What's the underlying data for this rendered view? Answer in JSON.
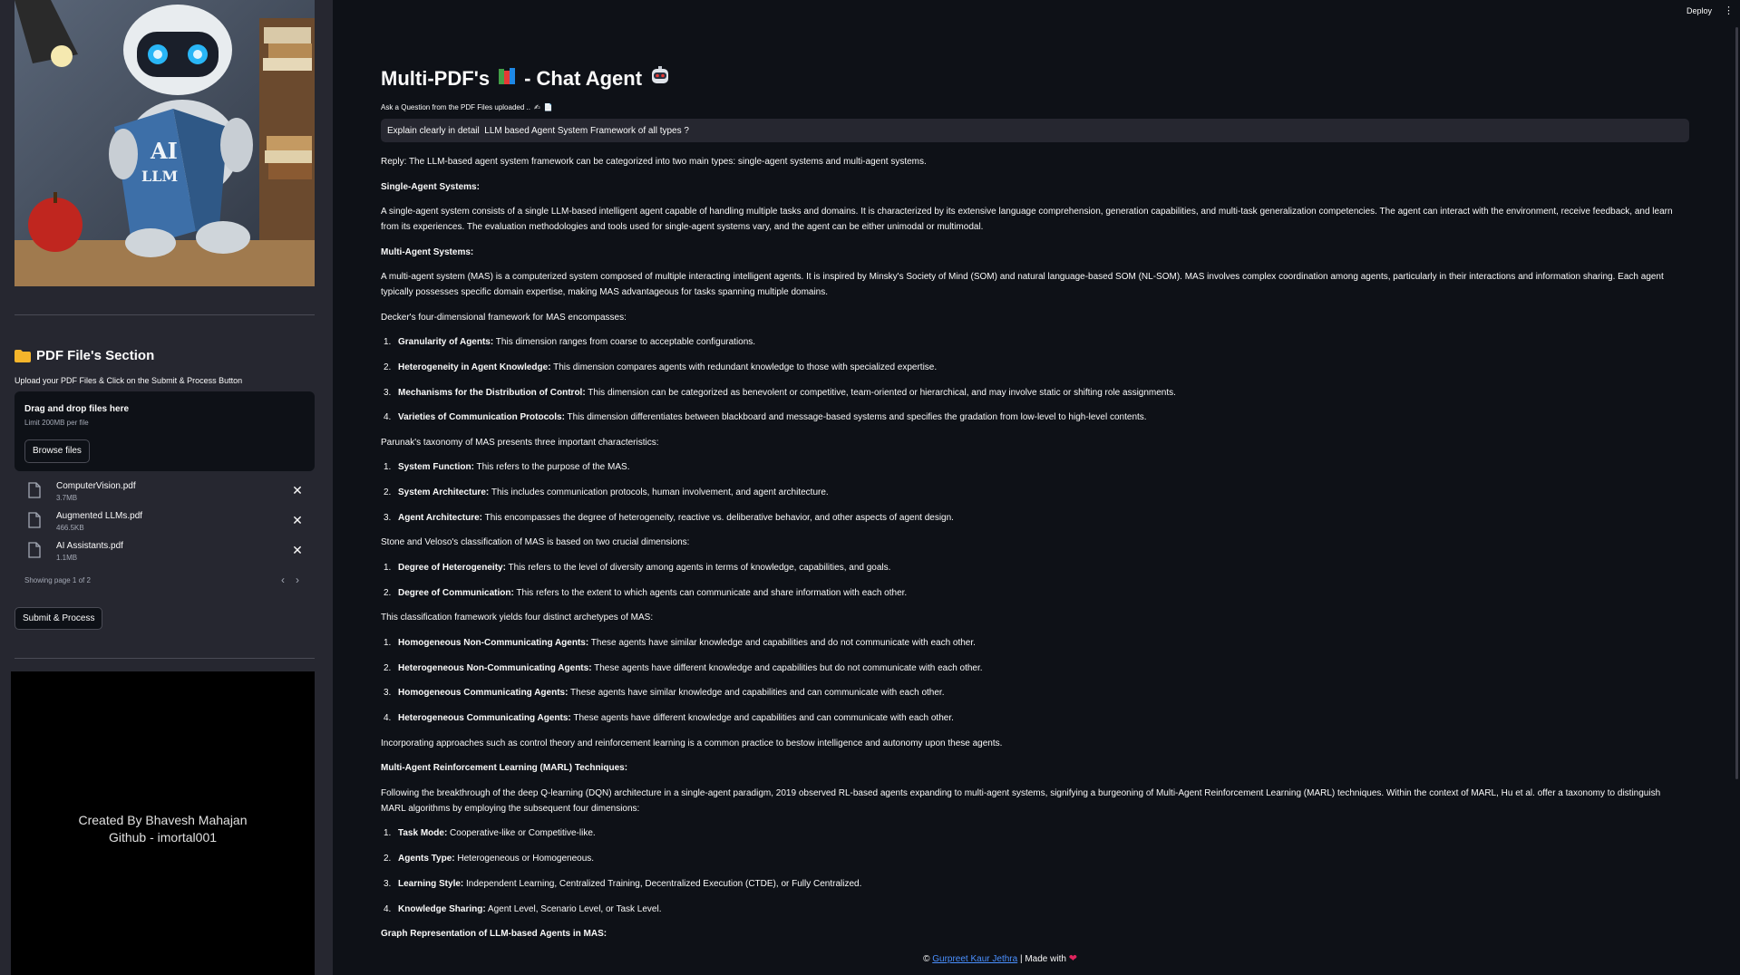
{
  "header": {
    "deploy_label": "Deploy",
    "more_label": "⋮"
  },
  "sidebar": {
    "section_title": "PDF File's Section",
    "upload_hint": "Upload your PDF Files & Click on the Submit & Process Button",
    "dropzone": {
      "title": "Drag and drop files here",
      "limit": "Limit 200MB per file",
      "browse_label": "Browse files"
    },
    "files": [
      {
        "name": "ComputerVision.pdf",
        "size": "3.7MB"
      },
      {
        "name": "Augmented LLMs.pdf",
        "size": "466.5KB"
      },
      {
        "name": "AI Assistants.pdf",
        "size": "1.1MB"
      }
    ],
    "pager_text": "Showing page 1 of 2",
    "submit_label": "Submit & Process",
    "credit_line1": "Created By Bhavesh Mahajan",
    "credit_line2": "Github - imortal001",
    "image_book_text": "AI LLM"
  },
  "main": {
    "title_part1": "Multi-PDF's",
    "title_part2": "- Chat Agent",
    "ask_label": "Ask a Question from the PDF Files uploaded ..",
    "question_value": "Explain clearly in detail  LLM based Agent System Framework of all types ?",
    "answer": {
      "reply": "Reply: The LLM-based agent system framework can be categorized into two main types: single-agent systems and multi-agent systems.",
      "h_single": "Single-Agent Systems:",
      "p_single": "A single-agent system consists of a single LLM-based intelligent agent capable of handling multiple tasks and domains. It is characterized by its extensive language comprehension, generation capabilities, and multi-task generalization competencies. The agent can interact with the environment, receive feedback, and learn from its experiences. The evaluation methodologies and tools used for single-agent systems vary, and the agent can be either unimodal or multimodal.",
      "h_multi": "Multi-Agent Systems:",
      "p_multi": "A multi-agent system (MAS) is a computerized system composed of multiple interacting intelligent agents. It is inspired by Minsky's Society of Mind (SOM) and natural language-based SOM (NL-SOM). MAS involves complex coordination among agents, particularly in their interactions and information sharing. Each agent typically possesses specific domain expertise, making MAS advantageous for tasks spanning multiple domains.",
      "p_decker": "Decker's four-dimensional framework for MAS encompasses:",
      "list_decker": [
        {
          "num": "1.",
          "term": "Granularity of Agents:",
          "desc": " This dimension ranges from coarse to acceptable configurations."
        },
        {
          "num": "2.",
          "term": "Heterogeneity in Agent Knowledge:",
          "desc": " This dimension compares agents with redundant knowledge to those with specialized expertise."
        },
        {
          "num": "3.",
          "term": "Mechanisms for the Distribution of Control:",
          "desc": " This dimension can be categorized as benevolent or competitive, team-oriented or hierarchical, and may involve static or shifting role assignments."
        },
        {
          "num": "4.",
          "term": "Varieties of Communication Protocols:",
          "desc": " This dimension differentiates between blackboard and message-based systems and specifies the gradation from low-level to high-level contents."
        }
      ],
      "p_parunak": "Parunak's taxonomy of MAS presents three important characteristics:",
      "list_parunak": [
        {
          "num": "1.",
          "term": "System Function:",
          "desc": " This refers to the purpose of the MAS."
        },
        {
          "num": "2.",
          "term": "System Architecture:",
          "desc": " This includes communication protocols, human involvement, and agent architecture."
        },
        {
          "num": "3.",
          "term": "Agent Architecture:",
          "desc": " This encompasses the degree of heterogeneity, reactive vs. deliberative behavior, and other aspects of agent design."
        }
      ],
      "p_stone": "Stone and Veloso's classification of MAS is based on two crucial dimensions:",
      "list_stone": [
        {
          "num": "1.",
          "term": "Degree of Heterogeneity:",
          "desc": " This refers to the level of diversity among agents in terms of knowledge, capabilities, and goals."
        },
        {
          "num": "2.",
          "term": "Degree of Communication:",
          "desc": " This refers to the extent to which agents can communicate and share information with each other."
        }
      ],
      "p_archetypes": "This classification framework yields four distinct archetypes of MAS:",
      "list_archetypes": [
        {
          "num": "1.",
          "term": "Homogeneous Non-Communicating Agents:",
          "desc": " These agents have similar knowledge and capabilities and do not communicate with each other."
        },
        {
          "num": "2.",
          "term": "Heterogeneous Non-Communicating Agents:",
          "desc": " These agents have different knowledge and capabilities but do not communicate with each other."
        },
        {
          "num": "3.",
          "term": "Homogeneous Communicating Agents:",
          "desc": " These agents have similar knowledge and capabilities and can communicate with each other."
        },
        {
          "num": "4.",
          "term": "Heterogeneous Communicating Agents:",
          "desc": " These agents have different knowledge and capabilities and can communicate with each other."
        }
      ],
      "p_incorp": "Incorporating approaches such as control theory and reinforcement learning is a common practice to bestow intelligence and autonomy upon these agents.",
      "h_marl": "Multi-Agent Reinforcement Learning (MARL) Techniques:",
      "p_marl": "Following the breakthrough of the deep Q-learning (DQN) architecture in a single-agent paradigm, 2019 observed RL-based agents expanding to multi-agent systems, signifying a burgeoning of Multi-Agent Reinforcement Learning (MARL) techniques. Within the context of MARL, Hu et al. offer a taxonomy to distinguish MARL algorithms by employing the subsequent four dimensions:",
      "list_marl": [
        {
          "num": "1.",
          "term": "Task Mode:",
          "desc": " Cooperative-like or Competitive-like."
        },
        {
          "num": "2.",
          "term": "Agents Type:",
          "desc": " Heterogeneous or Homogeneous."
        },
        {
          "num": "3.",
          "term": "Learning Style:",
          "desc": " Independent Learning, Centralized Training, Decentralized Execution (CTDE), or Fully Centralized."
        },
        {
          "num": "4.",
          "term": "Knowledge Sharing:",
          "desc": " Agent Level, Scenario Level, or Task Level."
        }
      ],
      "h_graph": "Graph Representation of LLM-based Agents in MAS:"
    }
  },
  "footer": {
    "copyright": "©",
    "author_link": "Gurpreet Kaur Jethra",
    "made_with": "| Made with"
  },
  "colors": {
    "background": "#0e1117",
    "sidebar": "#262730",
    "link": "#4a90ff",
    "heart": "#e0245e"
  }
}
